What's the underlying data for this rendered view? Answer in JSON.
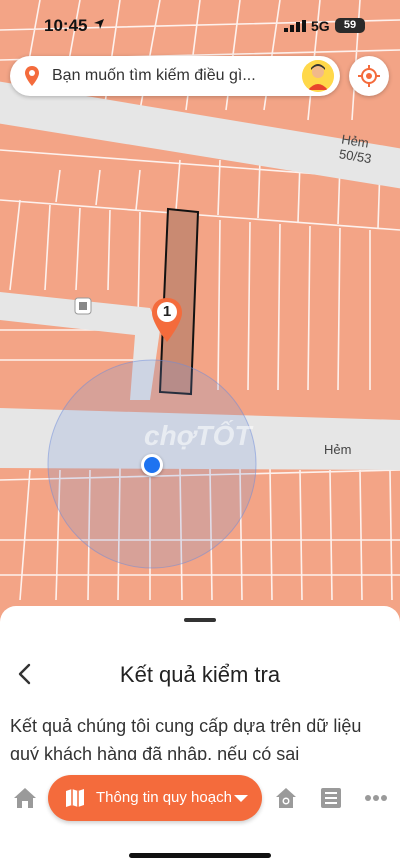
{
  "status_bar": {
    "time": "10:45",
    "network": "5G",
    "battery": "59"
  },
  "search": {
    "placeholder": "Bạn muốn tìm kiếm điều gì..."
  },
  "map": {
    "street_top": "Hẻm 50/53",
    "street_mid": "Hẻm",
    "marker_number": "1",
    "watermark": "chợTỐT"
  },
  "sheet": {
    "title": "Kết quả kiểm tra",
    "body": "Kết quả chúng tôi cung cấp dựa trên dữ liệu quý khách hàng đã nhập, nếu có sai"
  },
  "bottom_nav": {
    "plan_label": "Thông tin quy hoạch"
  },
  "icons": {
    "search_pin": "map-pin-icon",
    "locate": "crosshair-icon",
    "home": "home-icon",
    "house_search": "house-search-icon",
    "list": "list-icon",
    "more": "more-icon"
  },
  "colors": {
    "accent": "#f46b3c",
    "parcel_fill": "#f3a486",
    "road": "#e6e6e6",
    "highlight_lot": "#c98a72",
    "user_location": "#1e73f0"
  }
}
